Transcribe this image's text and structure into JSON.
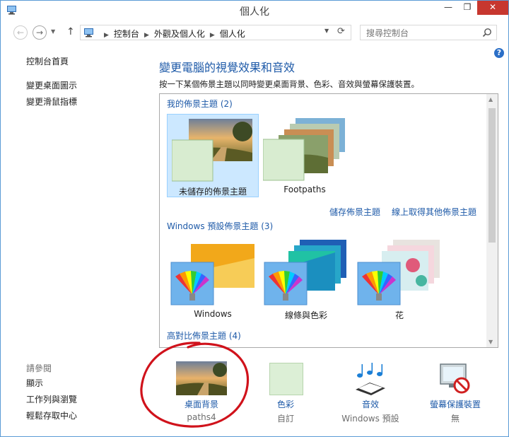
{
  "window": {
    "title": "個人化",
    "min_label": "—",
    "max_label": "❐",
    "close_label": "✕"
  },
  "address_bar": {
    "crumbs": [
      "控制台",
      "外觀及個人化",
      "個人化"
    ],
    "search_placeholder": "搜尋控制台"
  },
  "left_pane": {
    "home": "控制台首頁",
    "links": [
      "變更桌面圖示",
      "變更滑鼠指標"
    ],
    "see_also_title": "請參閱",
    "see_also": [
      "顯示",
      "工作列與瀏覽",
      "輕鬆存取中心"
    ]
  },
  "main": {
    "help": "?",
    "heading": "變更電腦的視覺效果和音效",
    "description": "按一下某個佈景主題以同時變更桌面背景、色彩、音效與螢幕保護裝置。",
    "my_themes_title": "我的佈景主題 (2)",
    "my_themes": [
      {
        "label": "未儲存的佈景主題",
        "selected": true
      },
      {
        "label": "Footpaths",
        "selected": false
      }
    ],
    "save_theme_link": "儲存佈景主題",
    "get_more_link": "線上取得其他佈景主題",
    "default_themes_title": "Windows 預設佈景主題 (3)",
    "default_themes": [
      {
        "label": "Windows"
      },
      {
        "label": "線條與色彩"
      },
      {
        "label": "花"
      }
    ],
    "high_contrast_title": "高對比佈景主題 (4)"
  },
  "bottom": {
    "items": [
      {
        "label": "桌面背景",
        "sub": "paths4"
      },
      {
        "label": "色彩",
        "sub": "自訂"
      },
      {
        "label": "音效",
        "sub": "Windows 預設"
      },
      {
        "label": "螢幕保護裝置",
        "sub": "無"
      }
    ]
  },
  "colors": {
    "accent": "#1e5aa8",
    "selected_bg": "#cce8ff",
    "annotation": "#d0121b",
    "close_button": "#c7372f"
  }
}
